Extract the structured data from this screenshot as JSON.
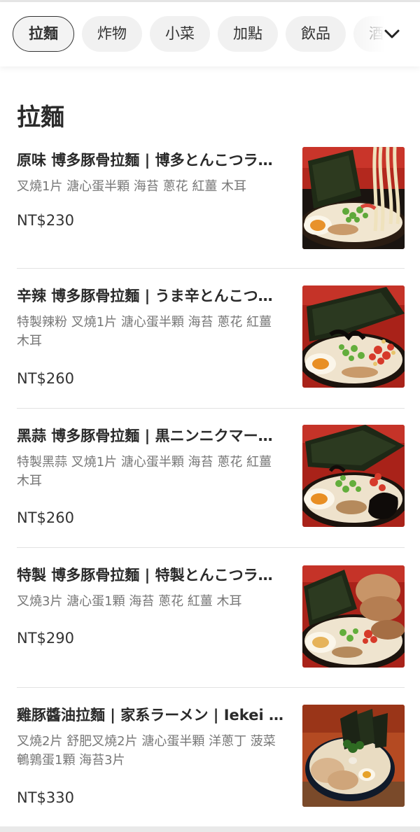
{
  "categories": [
    {
      "label": "拉麵",
      "active": true
    },
    {
      "label": "炸物",
      "active": false
    },
    {
      "label": "小菜",
      "active": false
    },
    {
      "label": "加點",
      "active": false
    },
    {
      "label": "飲品",
      "active": false
    },
    {
      "label": "酒精",
      "active": false
    }
  ],
  "section_title": "拉麵",
  "items": [
    {
      "name": "原味 博多豚骨拉麵 | 博多とんこつラーメン",
      "desc": "叉燒1片 溏心蛋半顆 海苔 蔥花 紅薑 木耳",
      "price": "NT$230",
      "image_icon": "tonkotsu-ramen-photo"
    },
    {
      "name": "辛辣 博多豚骨拉麵 | うま辛とんこつラーメン",
      "desc": "特製辣粉 叉燒1片 溏心蛋半顆 海苔 蔥花 紅薑 木耳",
      "price": "NT$260",
      "image_icon": "spicy-ramen-photo"
    },
    {
      "name": "黑蒜 博多豚骨拉麵 | 黒ニンニクマー油ラーメン",
      "desc": "特製黑蒜 叉燒1片 溏心蛋半顆 海苔 蔥花 紅薑 木耳",
      "price": "NT$260",
      "image_icon": "black-garlic-ramen-photo"
    },
    {
      "name": "特製 博多豚骨拉麵 | 特製とんこつラーメン",
      "desc": "叉燒3片 溏心蛋1顆 海苔 蔥花 紅薑 木耳",
      "price": "NT$290",
      "image_icon": "special-ramen-photo"
    },
    {
      "name": "雞豚醬油拉麵 | 家系ラーメン | Iekei Ramen",
      "desc": "叉燒2片 舒肥叉燒2片 溏心蛋半顆 洋蔥丁 菠菜 鵪鶉蛋1顆 海苔3片",
      "price": "NT$330",
      "image_icon": "iekei-ramen-photo"
    }
  ],
  "colors": {
    "chip_bg": "#f1f1f1",
    "active_chip_border": "#333333",
    "divider": "#e2e2e2",
    "desc_text": "#777777"
  },
  "icons": {
    "more_categories": "chevron-down-icon"
  }
}
